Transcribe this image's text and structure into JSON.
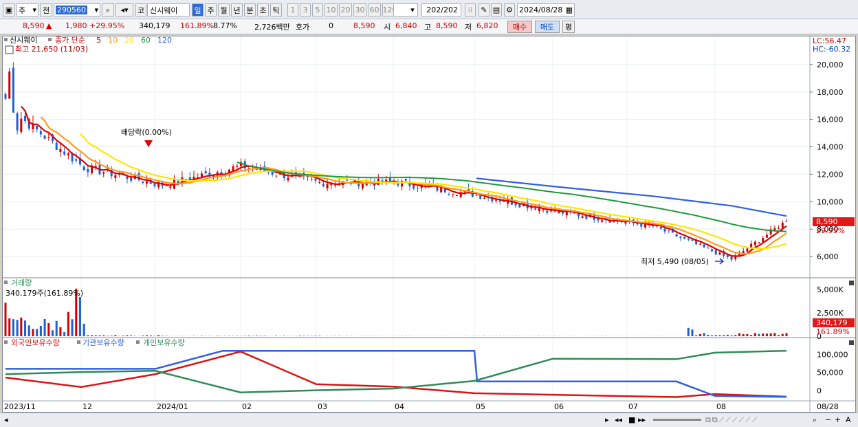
{
  "toolbar": {
    "type_label": "주",
    "prev_label": "전",
    "code_value": "290560",
    "code_badge": "코",
    "stock_name": "신시웨이",
    "periods": [
      "일",
      "주",
      "월",
      "년",
      "분",
      "초",
      "틱"
    ],
    "intervals": [
      "1",
      "3",
      "5",
      "10",
      "20",
      "30",
      "60",
      "120"
    ],
    "count_value": "202",
    "count_total": "/202",
    "date_value": "2024/08/28"
  },
  "quote": {
    "price": "8,590",
    "change": "1,980",
    "change_pct": "+29.95%",
    "volume": "340,179",
    "volume_pct": "161.89%",
    "turnover_rate": "8.77%",
    "amount": "2,726백만",
    "hoga_label": "호가",
    "hoga_value": "0",
    "hoga_price": "8,590",
    "open_label": "시",
    "open_value": "6,840",
    "high_label": "고",
    "high_value": "8,590",
    "low_label": "저",
    "low_value": "6,820",
    "buy_label": "매수",
    "sell_label": "매도",
    "eval_label": "평"
  },
  "price_panel": {
    "title": "신시웨이",
    "legend_prefix": "종가 단순",
    "ma_labels": [
      "5",
      "10",
      "20",
      "60",
      "120"
    ],
    "high_annotation": "최고 21,650 (11/03)",
    "low_annotation": "최저 5,490 (08/05)",
    "dividend_annotation": "배당락(0.00%)",
    "lc_label": "LC:56.47",
    "hc_label": "HC:-60.32",
    "last_price_tag": "8,590",
    "last_change_tag": "29.95%",
    "y_ticks": [
      "20,000",
      "18,000",
      "16,000",
      "14,000",
      "12,000",
      "10,000",
      "8,000",
      "6,000"
    ]
  },
  "volume_panel": {
    "title": "거래량",
    "annotation": "340,179주(161.89%)",
    "y_ticks": [
      "5,000K",
      "2,500K",
      "0"
    ],
    "last_tag": "340,179",
    "last_pct_tag": "161.89%"
  },
  "holding_panel": {
    "legend": [
      "외국인보유수량",
      "기관보유수량",
      "개인보유수량"
    ],
    "y_ticks": [
      "100,000",
      "50,000",
      "0"
    ]
  },
  "x_axis": {
    "labels": [
      "2023/11",
      "12",
      "2024/01",
      "02",
      "03",
      "04",
      "05",
      "06",
      "07",
      "08"
    ],
    "last_label": "08/28"
  },
  "colors": {
    "up": "#d00000",
    "down": "#1f5fd0",
    "ma5": "#e00000",
    "ma10": "#ff9a1a",
    "ma20": "#ffe600",
    "ma60": "#1e9a3c",
    "ma120": "#2f5fe0",
    "foreign": "#d81414",
    "institution": "#2f5fe0",
    "individual": "#2e8b57"
  },
  "chart_data": [
    {
      "type": "line",
      "title": "신시웨이",
      "x": [
        "2023/11",
        "12",
        "2024/01",
        "02",
        "03",
        "04",
        "05",
        "06",
        "07",
        "08",
        "08/28"
      ],
      "series": [
        {
          "name": "종가",
          "values": [
            17000,
            12500,
            11200,
            12600,
            11400,
            11400,
            10500,
            9300,
            8200,
            5800,
            8590
          ]
        },
        {
          "name": "120",
          "values": [
            null,
            null,
            null,
            null,
            null,
            null,
            11700,
            11100,
            10400,
            9700,
            8950
          ]
        }
      ],
      "ylim": [
        5000,
        21650
      ]
    },
    {
      "type": "bar",
      "title": "거래량",
      "categories": [
        "2023/11",
        "12",
        "2024/01",
        "02",
        "03",
        "04",
        "05",
        "06",
        "07",
        "08/28"
      ],
      "values": [
        5100000,
        300000,
        100000,
        150000,
        60000,
        50000,
        60000,
        40000,
        900000,
        340179
      ],
      "ylim": [
        0,
        5000000
      ]
    },
    {
      "type": "line",
      "x": [
        "2023/11",
        "12",
        "2024/01",
        "02",
        "03",
        "04",
        "05",
        "06",
        "07",
        "08",
        "08/28"
      ],
      "series": [
        {
          "name": "외국인보유수량",
          "values": [
            30000,
            10000,
            40000,
            110000,
            15000,
            10000,
            -10000,
            -15000,
            -18000,
            -10000,
            -12000
          ]
        },
        {
          "name": "기관보유수량",
          "values": [
            60000,
            60000,
            60000,
            110000,
            110000,
            110000,
            110000,
            25000,
            25000,
            -15000,
            -18000
          ]
        },
        {
          "name": "개인보유수량",
          "values": [
            50000,
            55000,
            60000,
            -10000,
            5000,
            10000,
            30000,
            85000,
            85000,
            105000,
            110000
          ]
        }
      ]
    }
  ]
}
